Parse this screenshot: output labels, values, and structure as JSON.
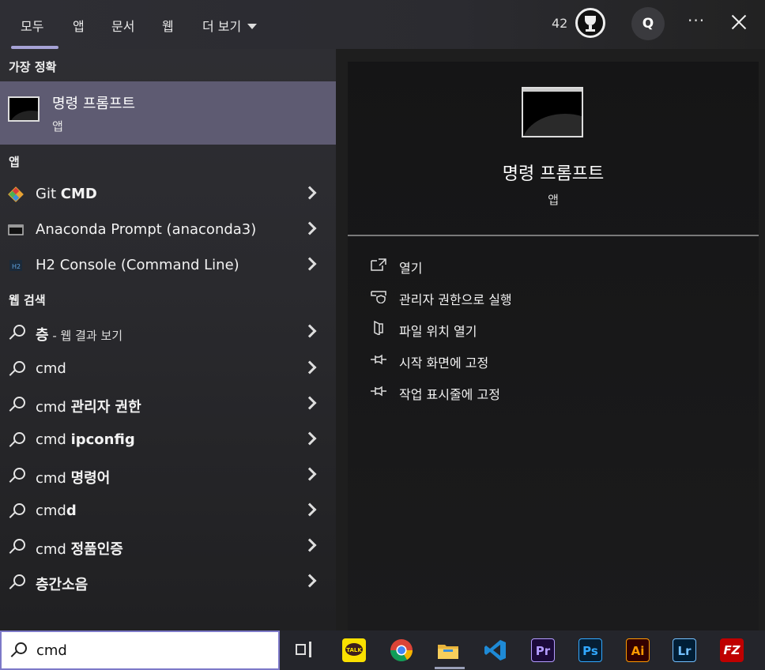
{
  "tabs": [
    "모두",
    "앱",
    "문서",
    "웹",
    "더 보기"
  ],
  "header": {
    "points": "42",
    "avatar_letter": "Q",
    "more": "···"
  },
  "best_match": {
    "section": "가장 정확",
    "title": "명령 프롬프트",
    "subtitle": "앱"
  },
  "apps": {
    "section": "앱",
    "items": [
      {
        "name_plain": "Git ",
        "name_bold": "CMD",
        "icon": "git-icon"
      },
      {
        "name_plain": "Anaconda Prompt (anaconda3)",
        "name_bold": "",
        "icon": "anaconda-prompt-icon"
      },
      {
        "name_plain": "H2 Console (Command Line)",
        "name_bold": "",
        "icon": "h2-console-icon"
      }
    ]
  },
  "web": {
    "section": "웹 검색",
    "items": [
      {
        "plain": "",
        "bold": "층",
        "suffix": " - 웹 결과 보기"
      },
      {
        "plain": "cmd",
        "bold": "",
        "suffix": ""
      },
      {
        "plain": "cmd ",
        "bold": "관리자 권한",
        "suffix": ""
      },
      {
        "plain": "cmd ",
        "bold": "ipconfig",
        "suffix": ""
      },
      {
        "plain": "cmd ",
        "bold": "명령어",
        "suffix": ""
      },
      {
        "plain": "cmd",
        "bold": "d",
        "suffix": ""
      },
      {
        "plain": "cmd ",
        "bold": "정품인증",
        "suffix": ""
      },
      {
        "plain": "",
        "bold": "층간소음",
        "suffix": ""
      }
    ]
  },
  "detail": {
    "title": "명령 프롬프트",
    "subtitle": "앱",
    "actions": [
      {
        "label": "열기",
        "icon": "open-icon"
      },
      {
        "label": "관리자 권한으로 실행",
        "icon": "shield-icon"
      },
      {
        "label": "파일 위치 열기",
        "icon": "folder-icon"
      },
      {
        "label": "시작 화면에 고정",
        "icon": "pin-icon"
      },
      {
        "label": "작업 표시줄에 고정",
        "icon": "pin-icon"
      }
    ]
  },
  "search": {
    "value": "cmd"
  },
  "taskbar": {
    "apps": [
      {
        "name": "task-view",
        "label": ""
      },
      {
        "name": "kakaotalk",
        "label": "TALK"
      },
      {
        "name": "chrome",
        "label": ""
      },
      {
        "name": "file-explorer",
        "label": ""
      },
      {
        "name": "vscode",
        "label": ""
      },
      {
        "name": "premiere",
        "label": "Pr"
      },
      {
        "name": "photoshop",
        "label": "Ps"
      },
      {
        "name": "illustrator",
        "label": "Ai"
      },
      {
        "name": "lightroom",
        "label": "Lr"
      },
      {
        "name": "filezilla",
        "label": "FZ"
      }
    ]
  }
}
